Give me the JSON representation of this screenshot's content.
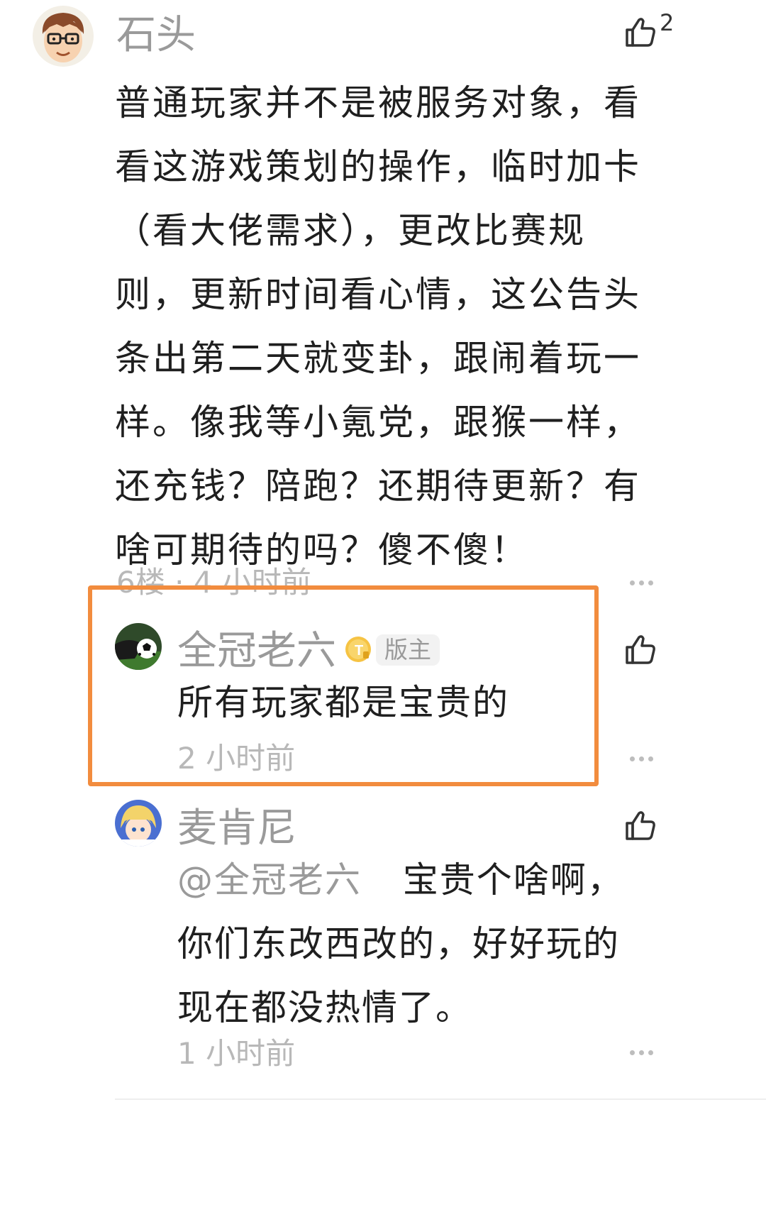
{
  "comment": {
    "author": "石头",
    "like_count": "2",
    "lines": [
      "普通玩家并不是被服务对象，看",
      "看这游戏策划的操作，临时加卡",
      "（看大佬需求），更改比赛规",
      "则，更新时间看心情，这公告头",
      "条出第二天就变卦，跟闹着玩一",
      "样。像我等小氪党，跟猴一样，",
      "还充钱？陪跑？还期待更新？有",
      "啥可期待的吗？傻不傻！"
    ],
    "meta": "6楼 · 4 小时前"
  },
  "replies": [
    {
      "author": "全冠老六",
      "badge": "版主",
      "text": "所有玩家都是宝贵的",
      "time": "2 小时前"
    },
    {
      "author": "麦肯尼",
      "mention": "@全冠老六",
      "lines": [
        "宝贵个啥啊，",
        "你们东改西改的，好好玩的",
        "现在都没热情了。"
      ],
      "time": "1 小时前"
    }
  ],
  "colors": {
    "highlight": "#f28c3e",
    "name": "#9a9a9a",
    "text": "#1f1f1f"
  },
  "icons": [
    "thumb-up-icon",
    "more-dots-icon",
    "vip-badge-icon"
  ]
}
